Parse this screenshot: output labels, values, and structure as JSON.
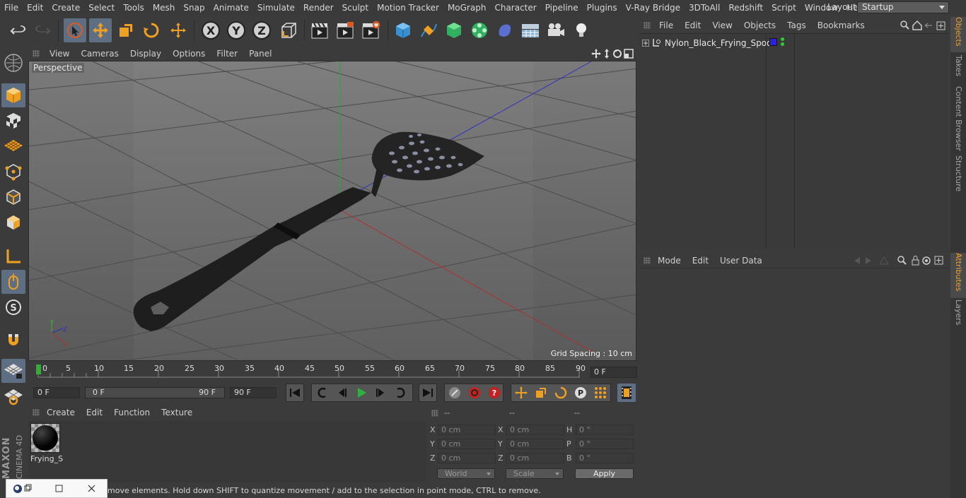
{
  "menu": [
    "File",
    "Edit",
    "Create",
    "Select",
    "Tools",
    "Mesh",
    "Snap",
    "Animate",
    "Simulate",
    "Render",
    "Sculpt",
    "Motion Tracker",
    "MoGraph",
    "Character",
    "Pipeline",
    "Plugins",
    "V-Ray Bridge",
    "3DToAll",
    "Redshift",
    "Script",
    "Window",
    "Help"
  ],
  "layout": {
    "label": "Layout:",
    "value": "Startup"
  },
  "viewport": {
    "menu": [
      "View",
      "Cameras",
      "Display",
      "Options",
      "Filter",
      "Panel"
    ],
    "camera_label": "Perspective",
    "grid_spacing": "Grid Spacing : 10 cm"
  },
  "timeline": {
    "ticks": [
      "0",
      "5",
      "10",
      "15",
      "20",
      "25",
      "30",
      "35",
      "40",
      "45",
      "50",
      "55",
      "60",
      "65",
      "70",
      "75",
      "80",
      "85",
      "90"
    ],
    "current_frame": "0 F"
  },
  "anim": {
    "start": "0 F",
    "range_start": "0 F",
    "range_end": "90 F",
    "end": "90 F"
  },
  "materials": {
    "menu": [
      "Create",
      "Edit",
      "Function",
      "Texture"
    ],
    "items": [
      {
        "name": "Frying_S"
      }
    ]
  },
  "coords": {
    "headers": [
      "--",
      "--",
      "--"
    ],
    "rows": [
      {
        "l1": "X",
        "v1": "0 cm",
        "l2": "X",
        "v2": "0 cm",
        "l3": "H",
        "v3": "0 °"
      },
      {
        "l1": "Y",
        "v1": "0 cm",
        "l2": "Y",
        "v2": "0 cm",
        "l3": "P",
        "v3": "0 °"
      },
      {
        "l1": "Z",
        "v1": "0 cm",
        "l2": "Z",
        "v2": "0 cm",
        "l3": "B",
        "v3": "0 °"
      }
    ],
    "world": "World",
    "scale": "Scale",
    "apply": "Apply"
  },
  "status": "move elements. Hold down SHIFT to quantize movement / add to the selection in point mode, CTRL to remove.",
  "branding": {
    "maxon": "MAXON",
    "cinema": "CINEMA 4D"
  },
  "objects": {
    "menu": [
      "File",
      "Edit",
      "View",
      "Objects",
      "Tags",
      "Bookmarks"
    ],
    "items": [
      {
        "name": "Nylon_Black_Frying_Spoon",
        "color": "#2a22e0"
      }
    ]
  },
  "attributes": {
    "menu": [
      "Mode",
      "Edit",
      "User Data"
    ]
  },
  "side_tabs": [
    "Objects",
    "Takes",
    "Content Browser",
    "Structure",
    "Attributes",
    "Layers"
  ],
  "colors": {
    "accent": "#5e6f84",
    "tab_active": "#f0a030",
    "axis_x": "#c03030",
    "axis_y": "#30a030",
    "axis_z": "#3030c0"
  }
}
